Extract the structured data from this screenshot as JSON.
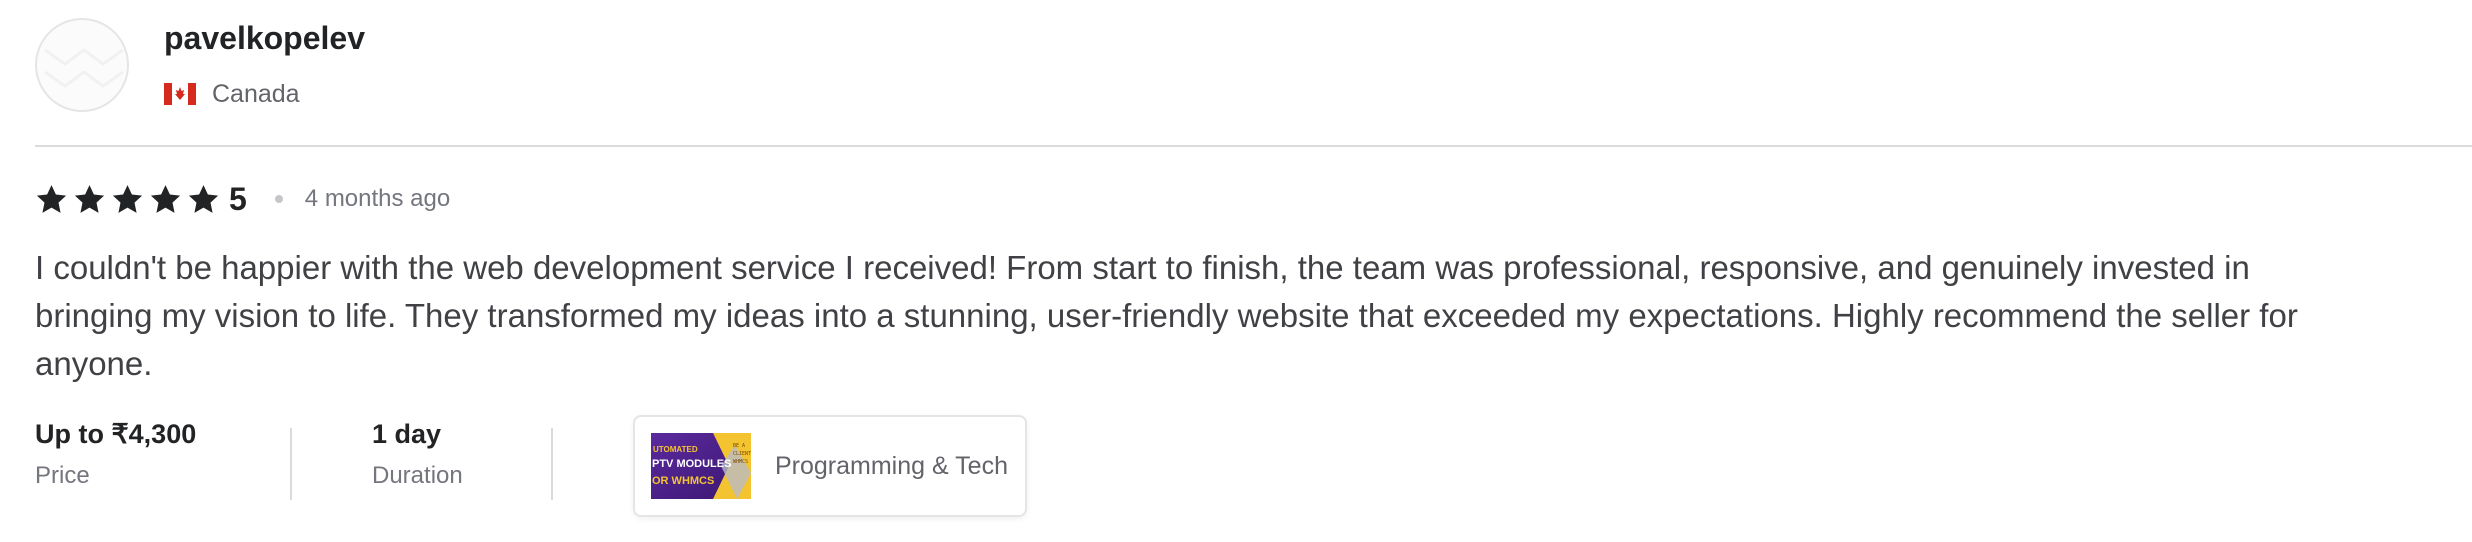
{
  "reviewer": {
    "username": "pavelkopelev",
    "country": "Canada",
    "flag_icon": "canada-flag-icon"
  },
  "review": {
    "rating": "5",
    "stars_filled": 5,
    "stars_total": 5,
    "date": "4 months ago",
    "text": "I couldn't be happier with the web development service I received! From start to finish, the team was professional, responsive, and genuinely invested in bringing my vision to life. They transformed my ideas into a stunning, user-friendly website that exceeded my expectations. Highly recommend the seller for anyone."
  },
  "details": {
    "price_value": "Up to ₹4,300",
    "price_label": "Price",
    "duration_value": "1 day",
    "duration_label": "Duration"
  },
  "gig": {
    "category": "Programming & Tech",
    "thumb_lines": [
      "UTOMATED",
      "PTV MODULES",
      "OR WHMCS"
    ]
  },
  "colors": {
    "text_dark": "#222325",
    "text_muted": "#74767e",
    "star": "#222325",
    "flag_red": "#d52b1e",
    "thumb_purple": "#4b1f8f",
    "thumb_yellow": "#f4c430"
  }
}
